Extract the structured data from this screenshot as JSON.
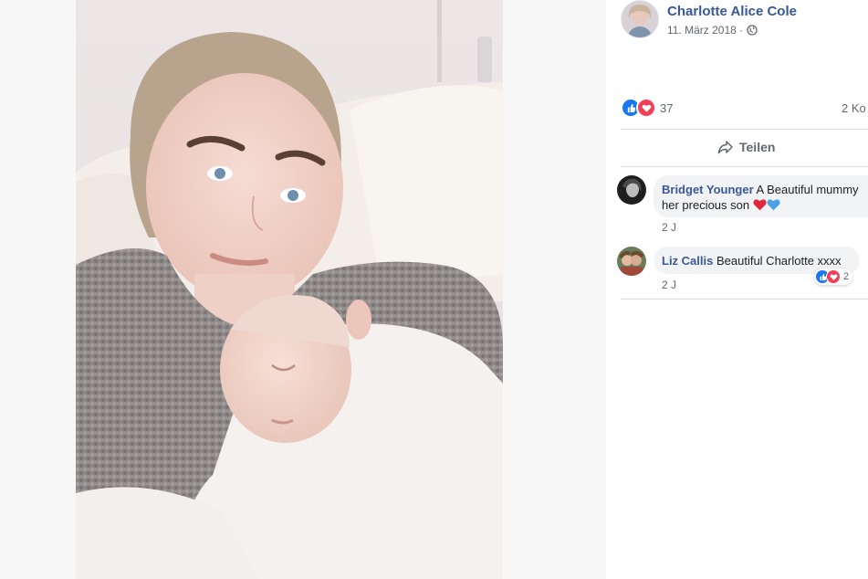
{
  "post": {
    "author_name": "Charlotte Alice Cole",
    "date": "11. März 2018",
    "date_separator": "·",
    "privacy_icon": "globe-icon",
    "photo_description_icon": "photo-image"
  },
  "stats": {
    "reaction_count": "37",
    "reaction_icons": [
      "like-icon",
      "love-icon"
    ],
    "comments_label": "2 Ko"
  },
  "actions": {
    "share_label": "Teilen",
    "share_icon": "share-arrow-icon"
  },
  "comments": [
    {
      "author": "Bridget Younger",
      "text_line1": "A Beautiful mummy",
      "text_line2": "her precious son",
      "emojis": [
        "red-heart",
        "blue-heart"
      ],
      "time": "2 J"
    },
    {
      "author": "Liz Callis",
      "text_line1": "Beautiful Charlotte xxxx",
      "time": "2 J",
      "reaction_count": "2"
    }
  ],
  "colors": {
    "link_blue": "#385898",
    "like_blue": "#1877f2",
    "love_red": "#f33e58",
    "meta_gray": "#606770",
    "bubble_gray": "#f2f3f5"
  }
}
